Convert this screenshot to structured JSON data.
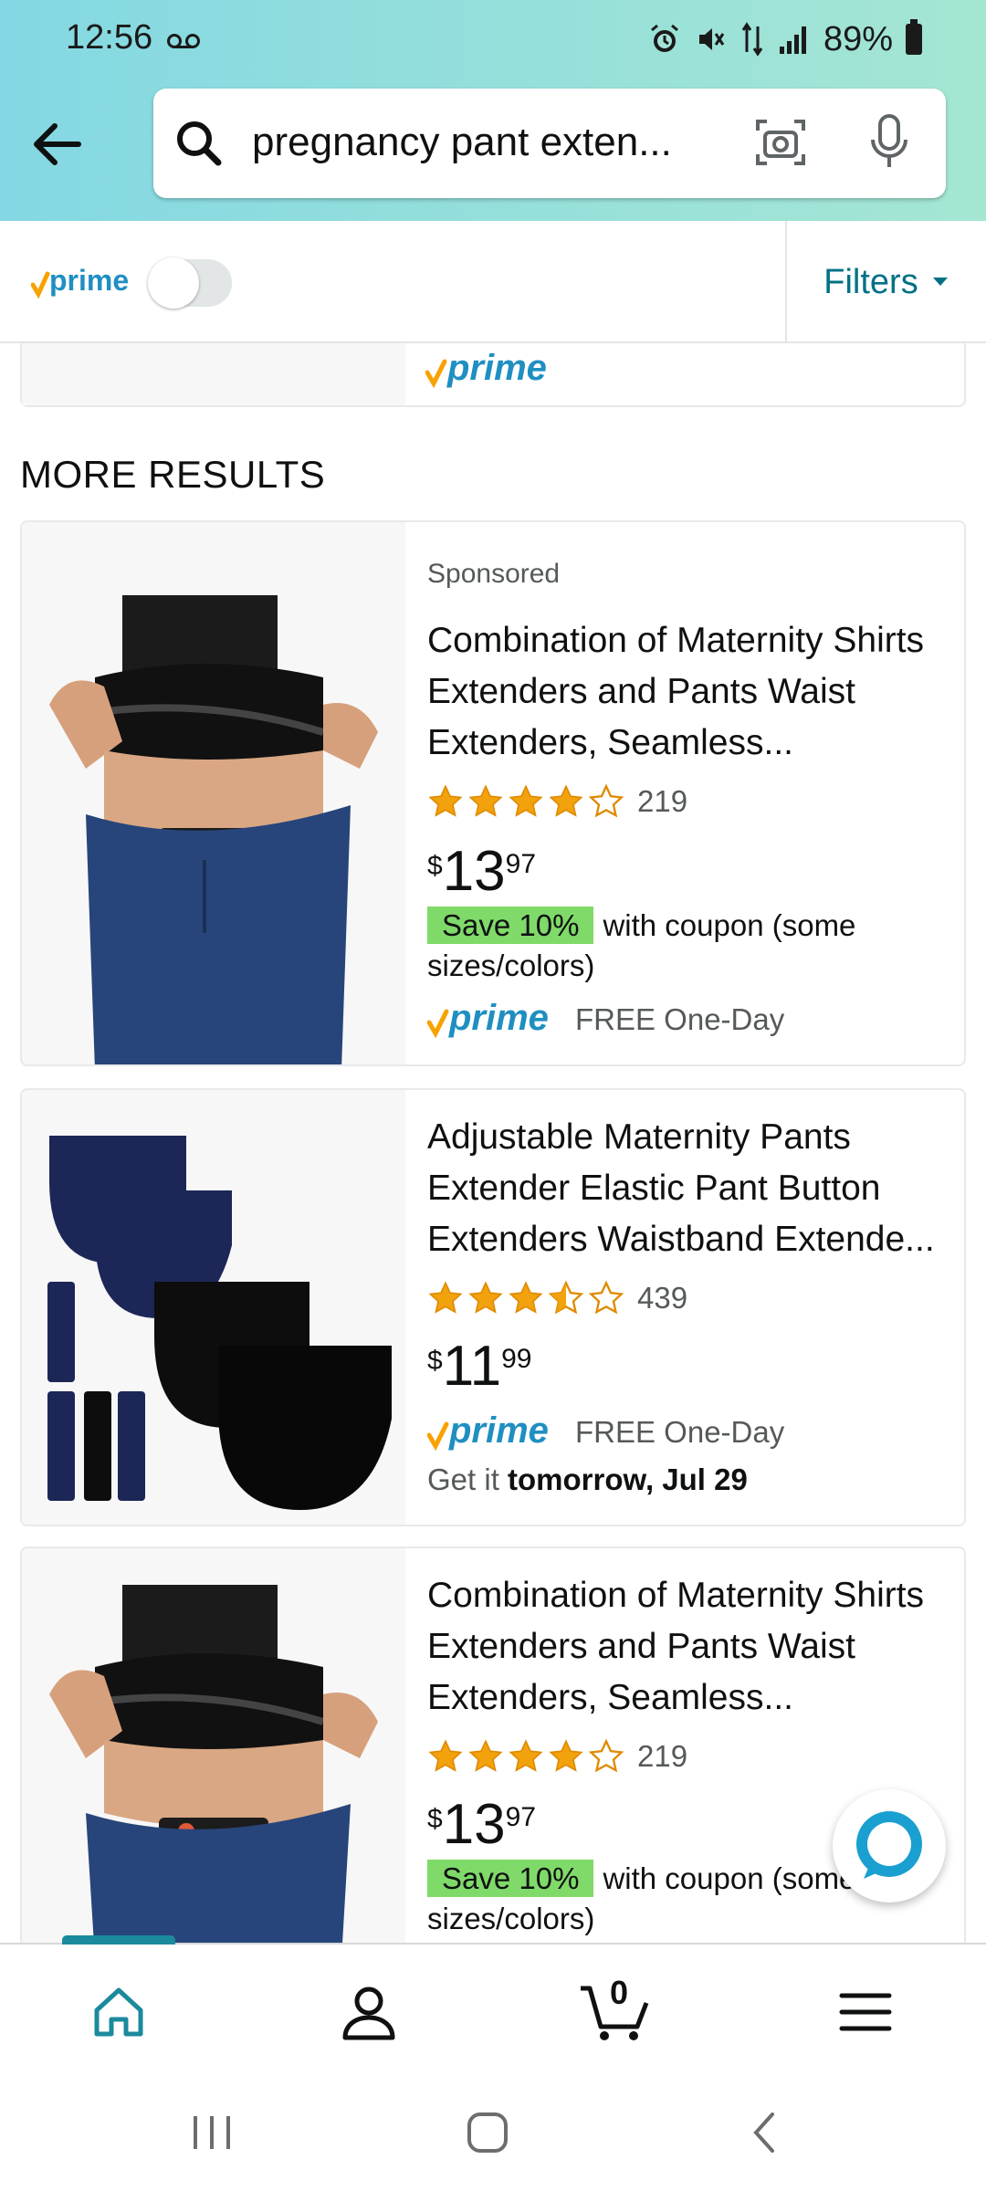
{
  "status_bar": {
    "time": "12:56",
    "battery": "89%"
  },
  "search": {
    "query": "pregnancy pant exten..."
  },
  "filter_bar": {
    "prime_label": "prime",
    "filters_label": "Filters"
  },
  "previous_card": {
    "prime_label": "prime"
  },
  "section_title": "MORE RESULTS",
  "products": [
    {
      "sponsored": "Sponsored",
      "title": "Combination of Maternity Shirts Extenders and Pants Waist Extenders, Seamless...",
      "rating": 4.0,
      "rating_count": "219",
      "price_currency": "$",
      "price_whole": "13",
      "price_fraction": "97",
      "coupon_badge": "Save 10%",
      "coupon_text": "with coupon (some sizes/colors)",
      "prime_label": "prime",
      "shipping": "FREE One-Day"
    },
    {
      "title": "Adjustable Maternity Pants Extender Elastic Pant Button Extenders Waistband Extende...",
      "rating": 3.5,
      "rating_count": "439",
      "price_currency": "$",
      "price_whole": "11",
      "price_fraction": "99",
      "prime_label": "prime",
      "shipping": "FREE One-Day",
      "delivery_prefix": "Get it",
      "delivery_date": "tomorrow, Jul 29"
    },
    {
      "title": "Combination of Maternity Shirts Extenders and Pants Waist Extenders, Seamless...",
      "rating": 4.0,
      "rating_count": "219",
      "price_currency": "$",
      "price_whole": "13",
      "price_fraction": "97",
      "coupon_badge": "Save 10%",
      "coupon_text": "with coupon (some sizes/colors)"
    }
  ],
  "bottom_nav": {
    "cart_count": "0"
  },
  "colors": {
    "accent_teal": "#007185",
    "prime_blue": "#1f8fc1",
    "prime_check": "#f7a200",
    "star": "#f2a20c",
    "coupon_green": "#7fda69"
  },
  "icons": [
    "back-arrow-icon",
    "search-icon",
    "camera-icon",
    "mic-icon",
    "home-icon",
    "account-icon",
    "cart-icon",
    "menu-icon",
    "alexa-icon"
  ]
}
